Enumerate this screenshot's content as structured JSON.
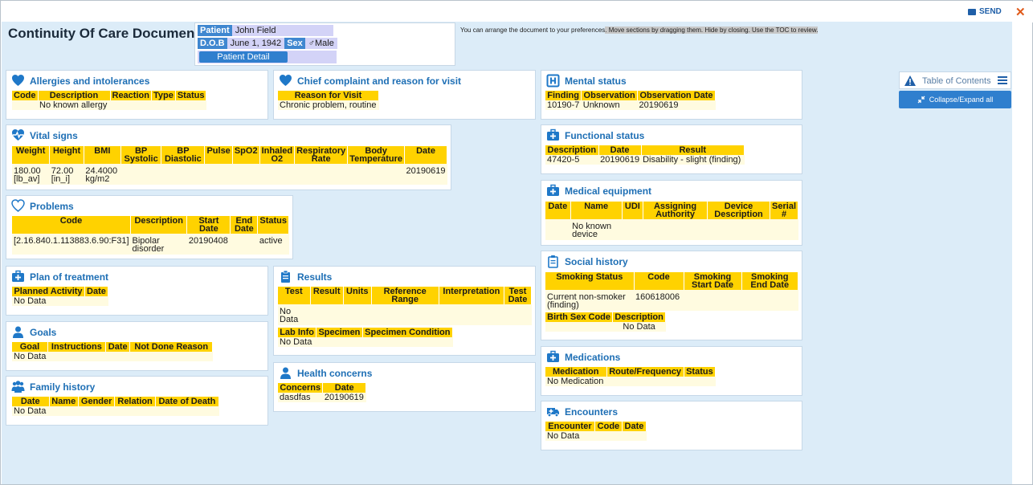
{
  "header": {
    "title": "Continuity Of Care Document",
    "send_label": "SEND",
    "close_label": "✕"
  },
  "patient": {
    "patient_label": "Patient",
    "patient_name": "John Field",
    "dob_label": "D.O.B",
    "dob_value": "June 1, 1942",
    "sex_label": "Sex",
    "sex_value": "♂Male",
    "detail_button": "Patient Detail"
  },
  "hint": {
    "part1": "You can arrange the document to your preferences",
    "part2": ". Move sections by dragging them. Hide by closing. Use the TOC to review."
  },
  "toc": {
    "label": "Table of Contents",
    "collapse_label": "Collapse/Expand all"
  },
  "sections": {
    "allergies": {
      "title": "Allergies and intolerances",
      "headers": [
        "Code",
        "Description",
        "Reaction",
        "Type",
        "Status"
      ],
      "rows": [
        [
          "",
          "No known allergy",
          "",
          "",
          ""
        ]
      ]
    },
    "chief": {
      "title": "Chief complaint and reason for visit",
      "headers": [
        "Reason for Visit"
      ],
      "rows": [
        [
          "Chronic problem, routine"
        ]
      ]
    },
    "vitals": {
      "title": "Vital signs",
      "headers": [
        "Weight",
        "Height",
        "BMI",
        "BP Systolic",
        "BP Diastolic",
        "Pulse",
        "SpO2",
        "Inhaled O2",
        "Respiratory Rate",
        "Body Temperature",
        "Date"
      ],
      "rows": [
        [
          "180.00 [lb_av]",
          "72.00 [in_i]",
          "24.4000 kg/m2",
          "",
          "",
          "",
          "",
          "",
          "",
          "",
          "20190619"
        ]
      ]
    },
    "problems": {
      "title": "Problems",
      "headers": [
        "Code",
        "Description",
        "Start Date",
        "End Date",
        "Status"
      ],
      "rows": [
        [
          "[2.16.840.1.113883.6.90:F31]",
          "Bipolar disorder",
          "20190408",
          "",
          "active"
        ]
      ]
    },
    "plan": {
      "title": "Plan of treatment",
      "headers": [
        "Planned Activity",
        "Date"
      ],
      "rows": [
        [
          "No Data",
          ""
        ]
      ]
    },
    "goals": {
      "title": "Goals",
      "headers": [
        "Goal",
        "Instructions",
        "Date",
        "Not Done Reason"
      ],
      "rows": [
        [
          "No Data",
          "",
          "",
          ""
        ]
      ]
    },
    "family": {
      "title": "Family history",
      "headers": [
        "Date",
        "Name",
        "Gender",
        "Relation",
        "Date of Death"
      ],
      "rows": [
        [
          "No Data",
          "",
          "",
          "",
          ""
        ]
      ]
    },
    "results": {
      "title": "Results",
      "headers": [
        "Test",
        "Result",
        "Units",
        "Reference Range",
        "Interpretation",
        "Test Date"
      ],
      "rows": [
        [
          "No Data",
          "",
          "",
          "",
          "",
          ""
        ]
      ],
      "headers2": [
        "Lab Info",
        "Specimen",
        "Specimen Condition"
      ],
      "rows2": [
        [
          "No Data",
          "",
          ""
        ]
      ]
    },
    "health": {
      "title": "Health concerns",
      "headers": [
        "Concerns",
        "Date"
      ],
      "rows": [
        [
          "dasdfas",
          "20190619"
        ]
      ]
    },
    "mental": {
      "title": "Mental status",
      "headers": [
        "Finding",
        "Observation",
        "Observation Date"
      ],
      "rows": [
        [
          "10190-7",
          "Unknown",
          "20190619"
        ]
      ]
    },
    "functional": {
      "title": "Functional status",
      "headers": [
        "Description",
        "Date",
        "Result"
      ],
      "rows": [
        [
          "47420-5",
          "20190619",
          "Disability - slight (finding)"
        ]
      ]
    },
    "equipment": {
      "title": "Medical equipment",
      "headers": [
        "Date",
        "Name",
        "UDI",
        "Assigning Authority",
        "Device Description",
        "Serial #"
      ],
      "rows": [
        [
          "",
          "No known device",
          "",
          "",
          "",
          ""
        ]
      ]
    },
    "social": {
      "title": "Social history",
      "headers": [
        "Smoking Status",
        "Code",
        "Smoking Start Date",
        "Smoking End Date"
      ],
      "rows": [
        [
          "Current non-smoker (finding)",
          "160618006",
          "",
          ""
        ]
      ],
      "headers2": [
        "Birth Sex Code",
        "Description"
      ],
      "rows2": [
        [
          "",
          "No Data"
        ]
      ]
    },
    "medications": {
      "title": "Medications",
      "headers": [
        "Medication",
        "Route/Frequency",
        "Status"
      ],
      "rows": [
        [
          "No Medication",
          "",
          ""
        ]
      ]
    },
    "encounters": {
      "title": "Encounters",
      "headers": [
        "Encounter",
        "Code",
        "Date"
      ],
      "rows": [
        [
          "No Data",
          "",
          ""
        ]
      ]
    }
  },
  "icons": {
    "heart": "heart-icon",
    "hospital": "hospital-icon",
    "medkit": "medkit-icon",
    "clipboard": "clipboard-icon",
    "people": "family-icon",
    "person": "person-icon"
  },
  "colors": {
    "header_blue": "#1e6fb5",
    "table_header": "#ffd200",
    "table_row": "#fffbe0",
    "canvas": "#dcecf8"
  }
}
